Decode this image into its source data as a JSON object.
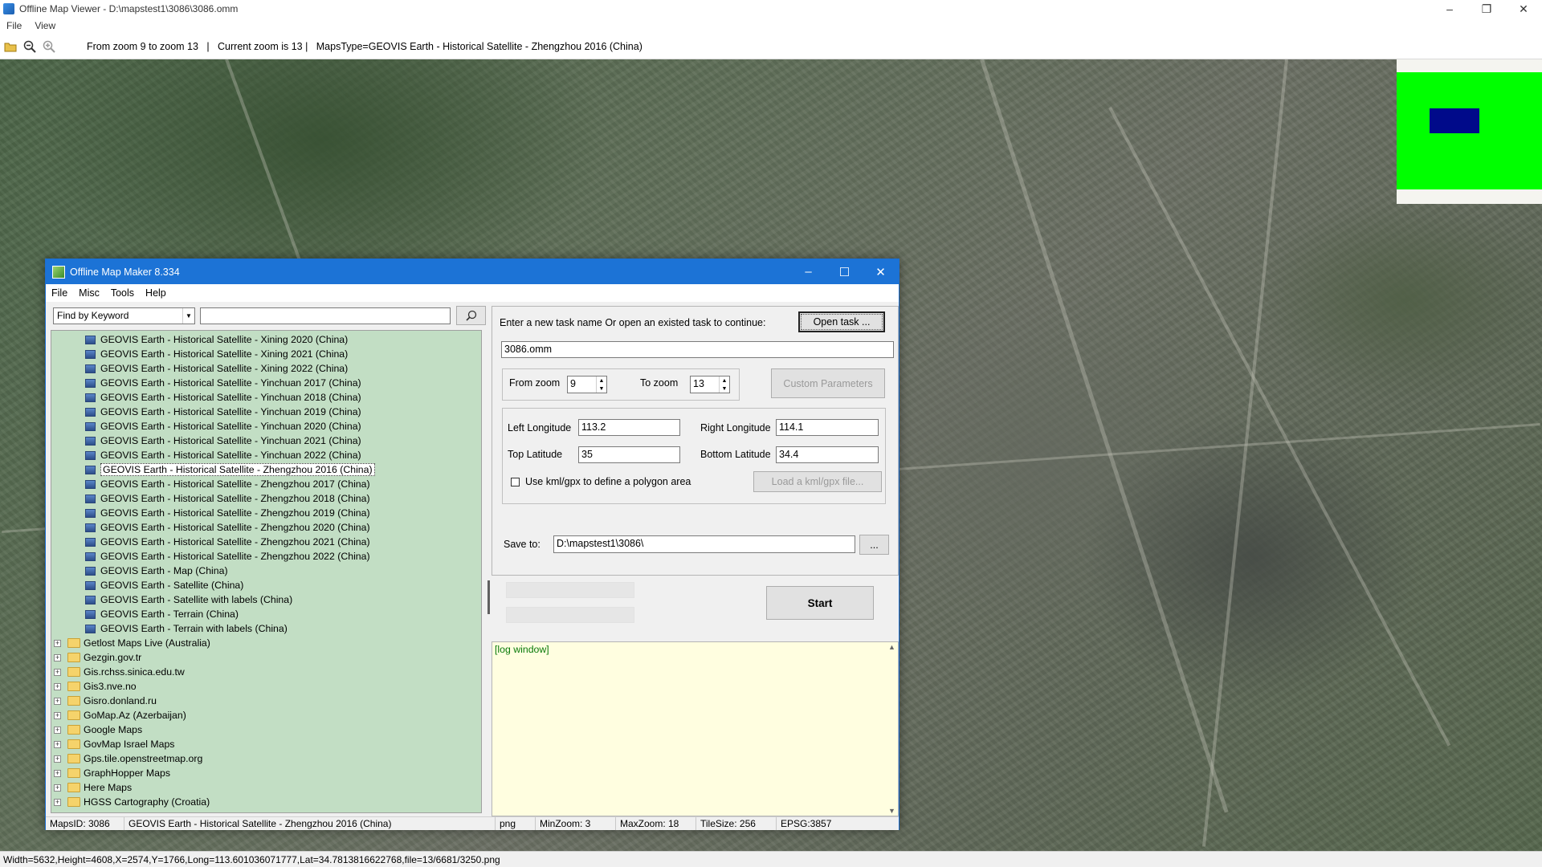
{
  "window": {
    "title": "Offline Map Viewer - D:\\mapstest1\\3086\\3086.omm",
    "controls": {
      "minimize": "–",
      "maximize": "❐",
      "close": "✕"
    }
  },
  "menu": [
    "File",
    "View"
  ],
  "toolbar": {
    "info": "From zoom 9 to zoom 13   |   Current zoom is 13 |   MapsType=GEOVIS Earth - Historical Satellite - Zhengzhou 2016 (China)"
  },
  "statusbar": {
    "text": "Width=5632,Height=4608,X=2574,Y=1766,Long=113.601036071777,Lat=34.7813816622768,file=13/6681/3250.png"
  },
  "dialog": {
    "title": "Offline Map Maker 8.334",
    "controls": {
      "minimize": "–",
      "maximize": "☐",
      "close": "✕"
    },
    "menu": [
      "File",
      "Misc",
      "Tools",
      "Help"
    ],
    "search": {
      "mode": "Find by Keyword",
      "value": ""
    },
    "tree_items": [
      {
        "label": "GEOVIS Earth - Historical Satellite - Xining 2020 (China)",
        "type": "map"
      },
      {
        "label": "GEOVIS Earth - Historical Satellite - Xining 2021 (China)",
        "type": "map"
      },
      {
        "label": "GEOVIS Earth - Historical Satellite - Xining 2022 (China)",
        "type": "map"
      },
      {
        "label": "GEOVIS Earth - Historical Satellite - Yinchuan 2017 (China)",
        "type": "map"
      },
      {
        "label": "GEOVIS Earth - Historical Satellite - Yinchuan 2018 (China)",
        "type": "map"
      },
      {
        "label": "GEOVIS Earth - Historical Satellite - Yinchuan 2019 (China)",
        "type": "map"
      },
      {
        "label": "GEOVIS Earth - Historical Satellite - Yinchuan 2020 (China)",
        "type": "map"
      },
      {
        "label": "GEOVIS Earth - Historical Satellite - Yinchuan 2021 (China)",
        "type": "map"
      },
      {
        "label": "GEOVIS Earth - Historical Satellite - Yinchuan 2022 (China)",
        "type": "map"
      },
      {
        "label": "GEOVIS Earth - Historical Satellite - Zhengzhou 2016 (China)",
        "type": "map",
        "selected": true
      },
      {
        "label": "GEOVIS Earth - Historical Satellite - Zhengzhou 2017 (China)",
        "type": "map"
      },
      {
        "label": "GEOVIS Earth - Historical Satellite - Zhengzhou 2018 (China)",
        "type": "map"
      },
      {
        "label": "GEOVIS Earth - Historical Satellite - Zhengzhou 2019 (China)",
        "type": "map"
      },
      {
        "label": "GEOVIS Earth - Historical Satellite - Zhengzhou 2020 (China)",
        "type": "map"
      },
      {
        "label": "GEOVIS Earth - Historical Satellite - Zhengzhou 2021 (China)",
        "type": "map"
      },
      {
        "label": "GEOVIS Earth - Historical Satellite - Zhengzhou 2022 (China)",
        "type": "map"
      },
      {
        "label": "GEOVIS Earth - Map (China)",
        "type": "map"
      },
      {
        "label": "GEOVIS Earth - Satellite (China)",
        "type": "map"
      },
      {
        "label": "GEOVIS Earth - Satellite with labels (China)",
        "type": "map"
      },
      {
        "label": "GEOVIS Earth - Terrain (China)",
        "type": "map"
      },
      {
        "label": "GEOVIS Earth - Terrain with labels (China)",
        "type": "map"
      },
      {
        "label": "Getlost Maps Live (Australia)",
        "type": "folder"
      },
      {
        "label": "Gezgin.gov.tr",
        "type": "folder"
      },
      {
        "label": "Gis.rchss.sinica.edu.tw",
        "type": "folder"
      },
      {
        "label": "Gis3.nve.no",
        "type": "folder"
      },
      {
        "label": "Gisro.donland.ru",
        "type": "folder"
      },
      {
        "label": "GoMap.Az (Azerbaijan)",
        "type": "folder"
      },
      {
        "label": "Google Maps",
        "type": "folder"
      },
      {
        "label": "GovMap Israel Maps",
        "type": "folder"
      },
      {
        "label": "Gps.tile.openstreetmap.org",
        "type": "folder"
      },
      {
        "label": "GraphHopper Maps",
        "type": "folder"
      },
      {
        "label": "Here Maps",
        "type": "folder"
      },
      {
        "label": "HGSS Cartography (Croatia)",
        "type": "folder"
      }
    ],
    "task_prompt": "Enter a new task name Or open an existed task to continue:",
    "open_task_label": "Open task ...",
    "task_name": "3086.omm",
    "from_zoom_label": "From zoom",
    "from_zoom": "9",
    "to_zoom_label": "To zoom",
    "to_zoom": "13",
    "custom_params_label": "Custom Parameters",
    "left_lon_label": "Left Longitude",
    "left_lon": "113.2",
    "right_lon_label": "Right Longitude",
    "right_lon": "114.1",
    "top_lat_label": "Top Latitude",
    "top_lat": "35",
    "bottom_lat_label": "Bottom Latitude",
    "bottom_lat": "34.4",
    "kml_label": "Use kml/gpx to define a polygon area",
    "kml_checked": false,
    "load_kml_label": "Load a kml/gpx file...",
    "save_to_label": "Save to:",
    "save_to": "D:\\mapstest1\\3086\\",
    "browse_label": "...",
    "start_label": "Start",
    "log_text": "[log window]",
    "status": {
      "maps_id": "MapsID: 3086",
      "maps_name": "GEOVIS Earth - Historical Satellite - Zhengzhou 2016 (China)",
      "format": "png",
      "min_zoom": "MinZoom: 3",
      "max_zoom": "MaxZoom: 18",
      "tile_size": "TileSize: 256",
      "epsg": "EPSG:3857"
    }
  },
  "colors": {
    "dialog_titlebar": "#1c73d6",
    "tree_background": "#c2dec4",
    "log_background": "#fffee0",
    "minimap_green": "#00ff00",
    "minimap_view": "#000a8a"
  }
}
